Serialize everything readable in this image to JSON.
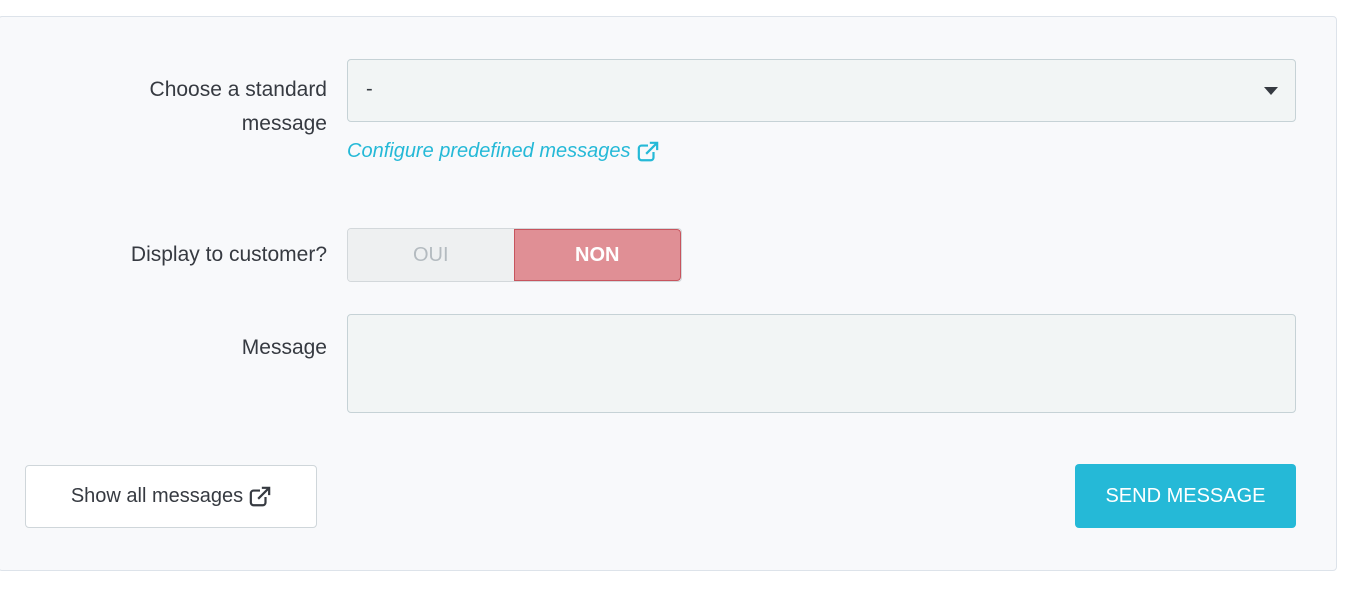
{
  "form": {
    "standard_message_label_line1": "Choose a standard",
    "standard_message_label_line2": "message",
    "standard_message_value": "-",
    "configure_link_label": "Configure predefined messages",
    "display_label": "Display to customer?",
    "toggle_yes": "OUI",
    "toggle_no": "NON",
    "toggle_selected": "NON",
    "message_label": "Message",
    "message_value": ""
  },
  "actions": {
    "show_all_label": "Show all messages",
    "send_label": "SEND MESSAGE"
  },
  "colors": {
    "accent": "#25b9d7",
    "toggle_off": "#e08f95",
    "panel_bg": "#f8f9fb"
  },
  "icons": {
    "external": "external-link-icon",
    "caret": "caret-down-icon"
  }
}
